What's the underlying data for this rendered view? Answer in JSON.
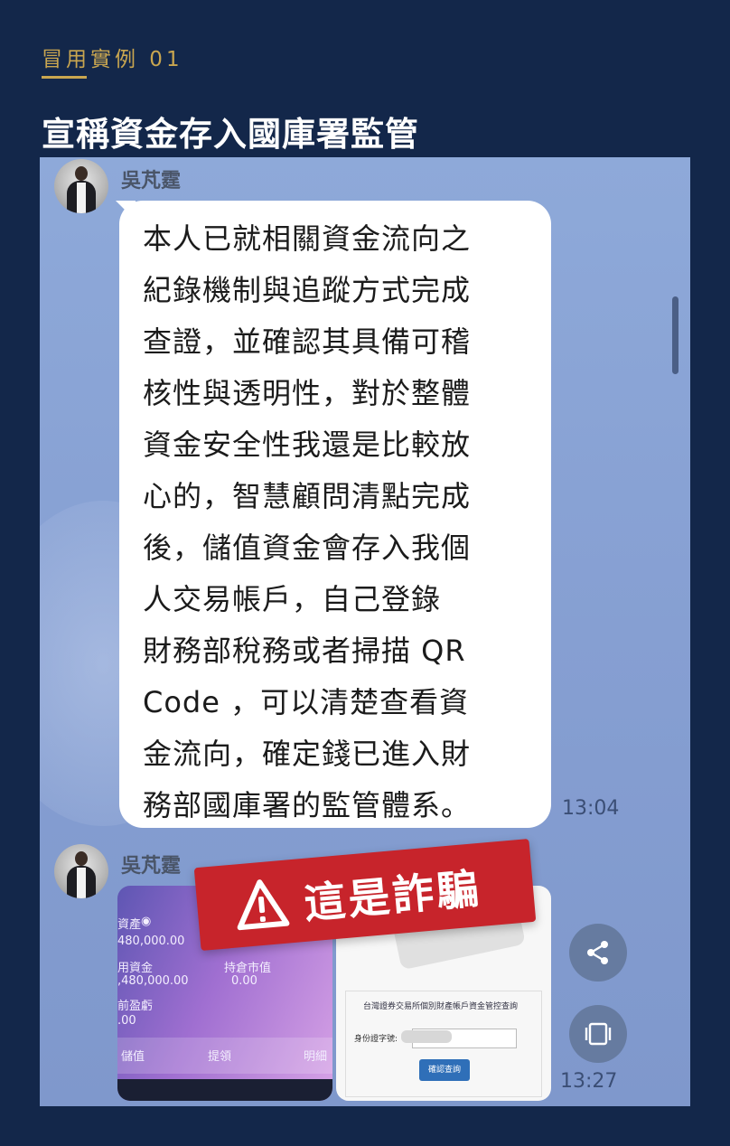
{
  "header": {
    "kicker": "冒用實例 01",
    "headline": "宣稱資金存入國庫署監管"
  },
  "chat": {
    "messages": [
      {
        "sender": "吳芃霆",
        "lines": [
          "本人已就相關資金流向之",
          "紀錄機制與追蹤方式完成",
          "查證，並確認其具備可稽",
          "核性與透明性，對於整體",
          "資金安全性我還是比較放",
          "心的，智慧顧問清點完成",
          "後，儲值資金會存入我個",
          "人交易帳戶，自己登錄",
          "財務部稅務或者掃描 QR",
          "Code ，可以清楚查看資",
          "金流向，確定錢已進入財",
          "務部國庫署的監管體系。"
        ],
        "time": "13:04"
      },
      {
        "sender": "吳芃霆",
        "time": "13:27",
        "left_image": {
          "lines": [
            "資產",
            "480,000.00",
            "用資金",
            "持倉市值",
            ",480,000.00",
            "0.00",
            "前盈虧",
            ".00"
          ],
          "tabs": [
            "儲值",
            "提領",
            "明細"
          ]
        },
        "right_image": {
          "title": "台灣證券交易所個別財產帳戶資金管控查詢",
          "label": "身份證字號:",
          "button": "確認查詢"
        }
      }
    ]
  },
  "warning": {
    "text": "這是詐騙",
    "color": "#c7242b"
  },
  "buttons": {
    "share_icon": "share-icon",
    "screen_icon": "screen-icon"
  },
  "colors": {
    "background": "#13274a",
    "accent_gold": "#c9a650",
    "chat_bg": "#8ea9d9"
  }
}
